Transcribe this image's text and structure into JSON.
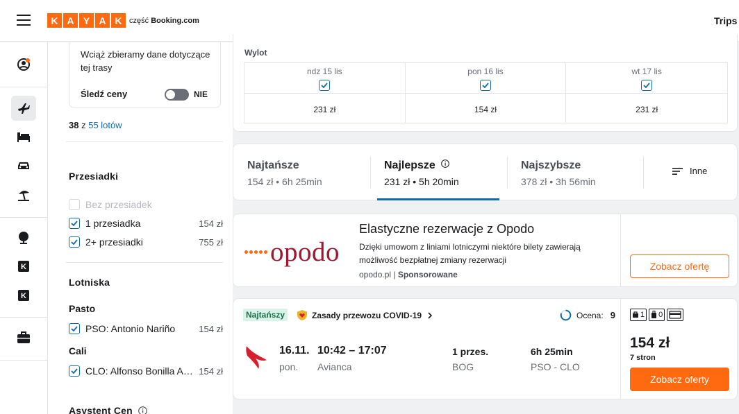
{
  "header": {
    "logo_letters": [
      "K",
      "A",
      "Y",
      "A",
      "K"
    ],
    "part_prefix": "część",
    "part_brand": "Booking.com",
    "trips": "Trips"
  },
  "icons": {
    "menu": "menu-icon",
    "account": "account-icon",
    "flights": "plane-icon",
    "stays": "bed-icon",
    "cars": "car-icon",
    "packages": "beach-umbrella-icon",
    "explore": "globe-icon",
    "kayak1": "kayak-k-icon",
    "kayak2": "kayak-k-icon",
    "trips": "briefcase-icon"
  },
  "track": {
    "text": "Wciąż zbieramy dane dotyczące tej trasy",
    "label": "Śledź ceny",
    "toggle": "NIE"
  },
  "count": {
    "shown": "38",
    "sep": "z",
    "total": "55 lotów"
  },
  "stops": {
    "title": "Przesiadki",
    "items": [
      {
        "label": "Bez przesiadek",
        "price": "",
        "checked": false,
        "disabled": true
      },
      {
        "label": "1 przesiadka",
        "price": "154 zł",
        "checked": true,
        "disabled": false
      },
      {
        "label": "2+ przesiadki",
        "price": "755 zł",
        "checked": true,
        "disabled": false
      }
    ]
  },
  "airports": {
    "title": "Lotniska",
    "groups": [
      {
        "city": "Pasto",
        "label": "PSO: Antonio Nariño",
        "price": "154 zł"
      },
      {
        "city": "Cali",
        "label": "CLO: Alfonso Bonilla Aragón",
        "price": "154 zł"
      }
    ]
  },
  "assistant": {
    "title": "Asystent Cen"
  },
  "dates": {
    "label": "Wylot",
    "cols": [
      {
        "day": "ndz 15 lis",
        "price": "231 zł"
      },
      {
        "day": "pon 16 lis",
        "price": "154 zł"
      },
      {
        "day": "wt 17 lis",
        "price": "231 zł"
      }
    ]
  },
  "sort": {
    "tabs": [
      {
        "title": "Najtańsze",
        "sub": "154 zł • 6h 25min"
      },
      {
        "title": "Najlepsze",
        "sub": "231 zł • 5h 20min"
      },
      {
        "title": "Najszybsze",
        "sub": "378 zł • 3h 56min"
      }
    ],
    "more": "Inne"
  },
  "ad": {
    "brand": "opodo",
    "title": "Elastyczne rezerwacje z Opodo",
    "desc": "Dzięki umowom z liniami lotniczymi niektóre bilety zawierają możliwość bezpłatnej zmiany rezerwacji",
    "domain": "opodo.pl",
    "sponsored": "Sponsorowane",
    "button": "Zobacz ofertę"
  },
  "result": {
    "badge": "Najtańszy",
    "covid": "Zasady przewozu COVID-19",
    "rating_label": "Ocena:",
    "rating_value": "9",
    "date": "16.11.",
    "day": "pon.",
    "time": "10:42 – 17:07",
    "airline": "Avianca",
    "stops": "1 przes.",
    "via": "BOG",
    "duration": "6h 25min",
    "route": "PSO - CLO",
    "bag1": "1",
    "bag2": "0",
    "price": "154 zł",
    "sites": "7 stron",
    "button": "Zobacz oferty"
  },
  "colors": {
    "accent": "#ff690f",
    "link": "#0f6ba8",
    "opodo": "#a3172e",
    "badge_bg": "#d9f3e8",
    "avianca": "#d8202c"
  }
}
